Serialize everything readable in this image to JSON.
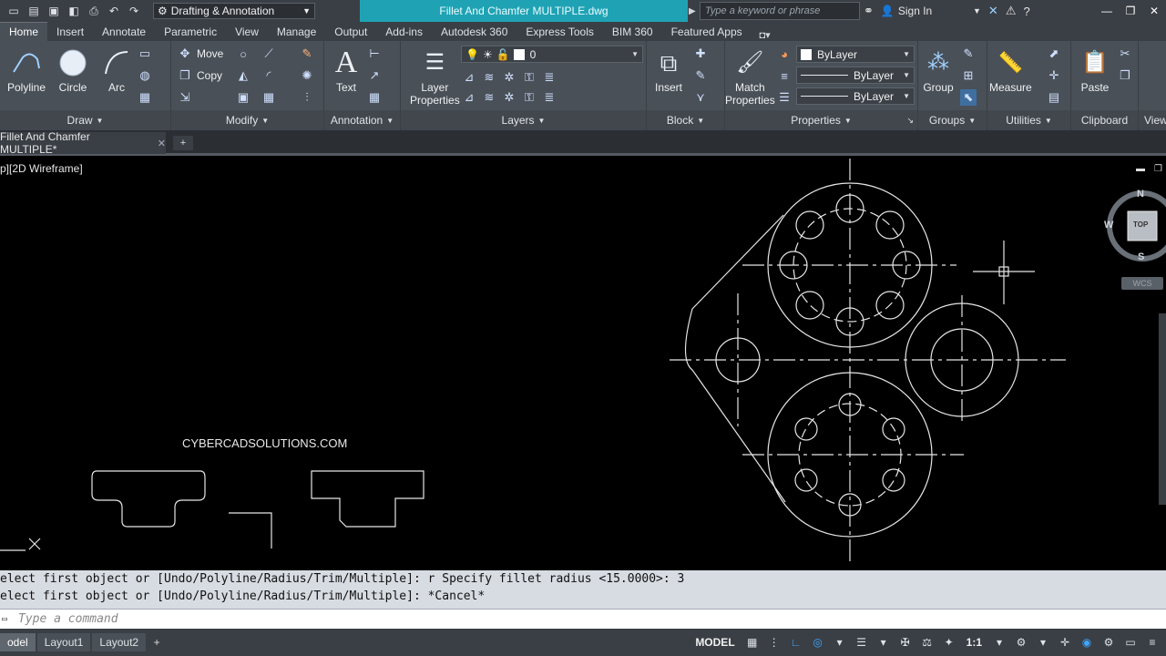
{
  "titlebar": {
    "workspace": "Drafting & Annotation",
    "document_title": "Fillet And Chamfer MULTIPLE.dwg",
    "search_placeholder": "Type a keyword or phrase",
    "sign_in": "Sign In"
  },
  "tabs": [
    "Home",
    "Insert",
    "Annotate",
    "Parametric",
    "View",
    "Manage",
    "Output",
    "Add-ins",
    "Autodesk 360",
    "Express Tools",
    "BIM 360",
    "Featured Apps"
  ],
  "ribbon": {
    "draw": {
      "title": "Draw",
      "polyline": "Polyline",
      "circle": "Circle",
      "arc": "Arc"
    },
    "modify": {
      "title": "Modify",
      "move": "Move",
      "copy": "Copy"
    },
    "annotation": {
      "title": "Annotation",
      "text": "Text"
    },
    "layers": {
      "title": "Layers",
      "layer_properties_1": "Layer",
      "layer_properties_2": "Properties",
      "current_layer": "0"
    },
    "block": {
      "title": "Block",
      "insert": "Insert"
    },
    "properties": {
      "title": "Properties",
      "match_1": "Match",
      "match_2": "Properties",
      "color": "ByLayer",
      "linetype": "ByLayer",
      "lineweight": "ByLayer"
    },
    "groups": {
      "title": "Groups",
      "group": "Group"
    },
    "utilities": {
      "title": "Utilities",
      "measure": "Measure"
    },
    "clipboard": {
      "title": "Clipboard",
      "paste": "Paste"
    },
    "view": {
      "title": "View"
    }
  },
  "file_tab": "Fillet And Chamfer MULTIPLE*",
  "viewport_label": "p][2D Wireframe]",
  "watermark": "CYBERCADSOLUTIONS.COM",
  "navcube": {
    "n": "N",
    "w": "W",
    "s": "S",
    "top": "TOP",
    "wcs": "WCS"
  },
  "command": {
    "line1": "elect first object or [Undo/Polyline/Radius/Trim/Multiple]: r Specify fillet radius <15.0000>: 3",
    "line2": "elect first object or [Undo/Polyline/Radius/Trim/Multiple]: *Cancel*",
    "placeholder": "Type a command"
  },
  "layout_tabs": [
    "odel",
    "Layout1",
    "Layout2"
  ],
  "status": {
    "model": "MODEL",
    "scale": "1:1"
  }
}
